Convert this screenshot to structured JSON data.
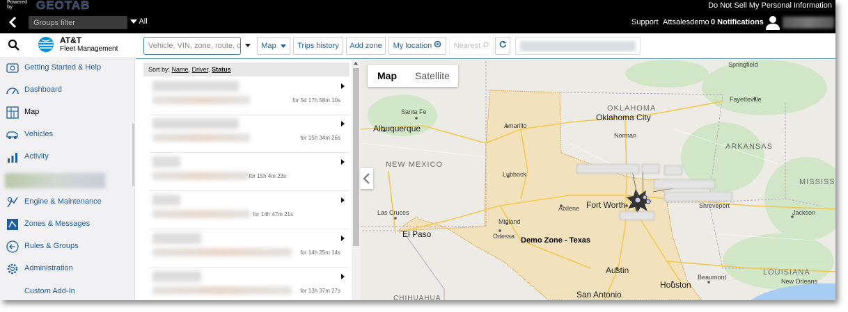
{
  "powered": {
    "label": "Powered by",
    "logo": "GEOTAB"
  },
  "top_links": {
    "do_not_sell": "Do Not Sell My Personal Information"
  },
  "header": {
    "groups_filter_placeholder": "Groups filter",
    "all_label": "All",
    "support": "Support",
    "user": "Attsalesdemo",
    "notifications": "0 Notifications"
  },
  "brand": {
    "name": "AT&T",
    "sub": "Fleet Management"
  },
  "sidebar": {
    "items": [
      {
        "label": "Getting Started & Help",
        "icon": "help-icon"
      },
      {
        "label": "Dashboard",
        "icon": "dashboard-icon"
      },
      {
        "label": "Map",
        "icon": "map-icon"
      },
      {
        "label": "Vehicles",
        "icon": "vehicle-icon"
      },
      {
        "label": "Activity",
        "icon": "activity-icon"
      },
      {
        "label": "Engine & Maintenance",
        "icon": "engine-icon"
      },
      {
        "label": "Zones & Messages",
        "icon": "zones-icon"
      },
      {
        "label": "Rules & Groups",
        "icon": "rules-icon"
      },
      {
        "label": "Administration",
        "icon": "gear-icon"
      },
      {
        "label": "Custom Add-In",
        "icon": ""
      }
    ]
  },
  "toolbar": {
    "search_placeholder": "Vehicle, VIN, zone, route, or a",
    "map": "Map",
    "trips_history": "Trips history",
    "add_zone": "Add zone",
    "my_location": "My location",
    "nearest": "Nearest"
  },
  "list": {
    "sort_prefix": "Sort by:",
    "sort_name": "Name",
    "sort_driver": "Driver",
    "sort_status": "Status",
    "rows": [
      {
        "duration": "for 5d 17h 58m 10s"
      },
      {
        "duration": "for 15h 34m 26s"
      },
      {
        "duration": "for 15h 4m 23s"
      },
      {
        "duration": "for 14h 47m 21s"
      },
      {
        "duration": "for 14h 25m 14s"
      },
      {
        "duration": "for 13h 37m 27s"
      }
    ]
  },
  "map": {
    "type_map": "Map",
    "type_satellite": "Satellite",
    "zone_name": "Demo Zone - Texas",
    "zone_color": "#f6dca8",
    "labels": {
      "oklahoma": "OKLAHOMA",
      "arkansas": "ARKANSAS",
      "new_mexico": "NEW MEXICO",
      "mississippi": "MISSISSIPI",
      "louisiana": "LOUISIANA",
      "chihuahua": "CHIHUAHUA",
      "springfield": "Springfield",
      "fayetteville": "Fayetteville",
      "oklahoma_city": "Oklahoma City",
      "norman": "Norman",
      "santa_fe": "Santa Fe",
      "albuquerque": "Albuquerque",
      "amarillo": "Amarillo",
      "lubbock": "Lubbock",
      "abilene": "Abilene",
      "fort_worth": "Fort Worth",
      "shreveport": "Shreveport",
      "jackson": "Jackson",
      "las_cruces": "Las Cruces",
      "el_paso": "El Paso",
      "midland": "Midland",
      "odessa": "Odessa",
      "austin": "Austin",
      "houston": "Houston",
      "beaumont": "Beaumont",
      "new_orleans": "New Orleans",
      "san_antonio": "San Antonio"
    }
  }
}
